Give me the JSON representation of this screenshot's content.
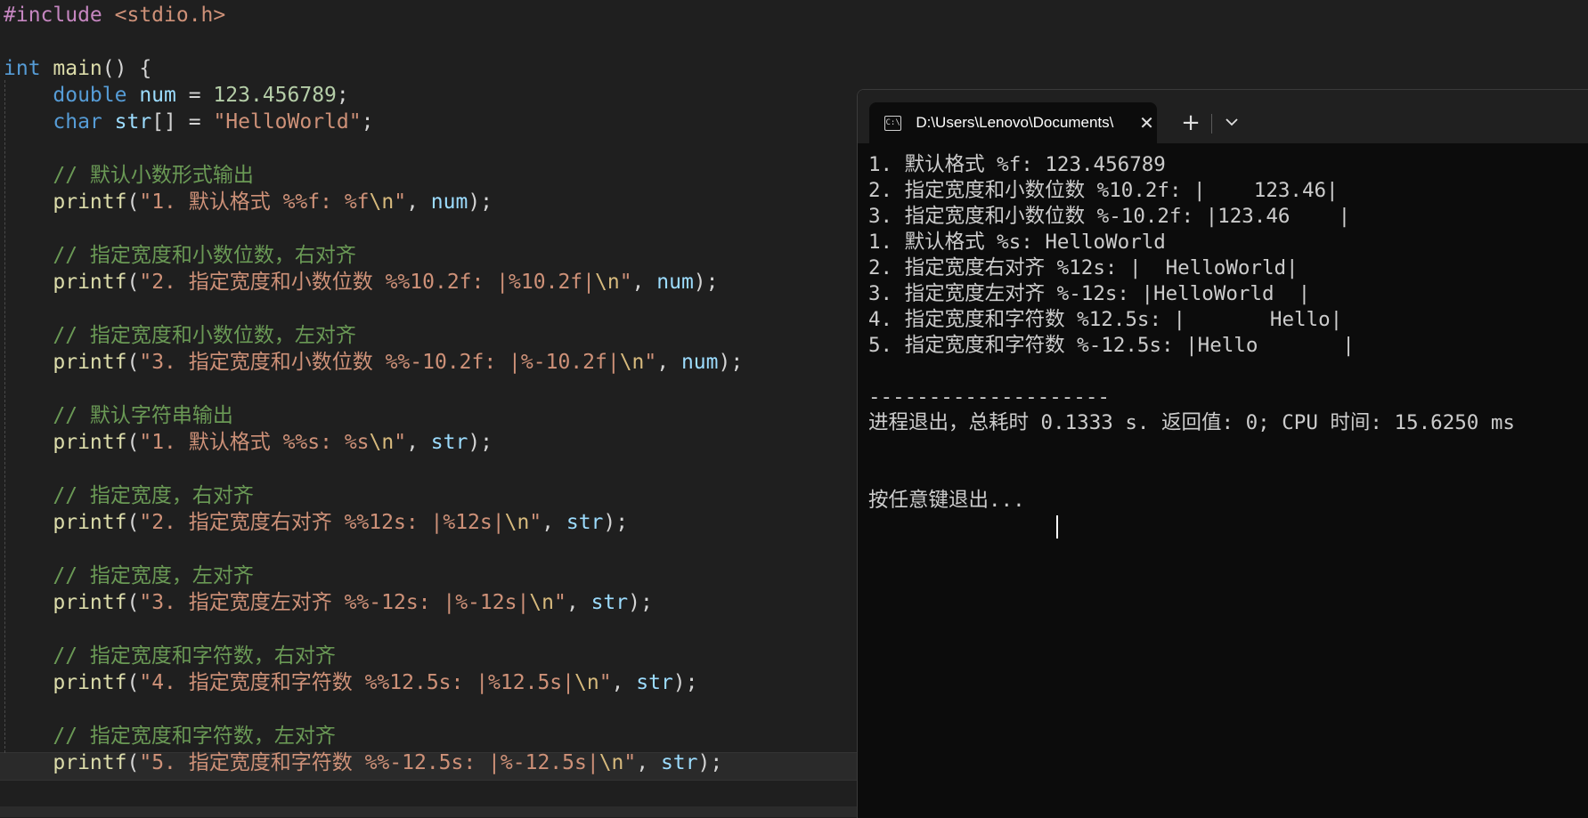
{
  "editor": {
    "lines": [
      [
        {
          "c": "t-dir",
          "t": "#include "
        },
        {
          "c": "t-inc",
          "t": "<stdio.h>"
        }
      ],
      [],
      [
        {
          "c": "t-kw",
          "t": "int "
        },
        {
          "c": "t-fn",
          "t": "main"
        },
        {
          "c": "t-pun",
          "t": "() {"
        }
      ],
      [
        {
          "c": "t-pun",
          "t": "    "
        },
        {
          "c": "t-kw",
          "t": "double "
        },
        {
          "c": "t-var",
          "t": "num"
        },
        {
          "c": "t-pun",
          "t": " = "
        },
        {
          "c": "t-num",
          "t": "123.456789"
        },
        {
          "c": "t-pun",
          "t": ";"
        }
      ],
      [
        {
          "c": "t-pun",
          "t": "    "
        },
        {
          "c": "t-kw",
          "t": "char "
        },
        {
          "c": "t-var",
          "t": "str"
        },
        {
          "c": "t-pun",
          "t": "[] = "
        },
        {
          "c": "t-str",
          "t": "\"HelloWorld\""
        },
        {
          "c": "t-pun",
          "t": ";"
        }
      ],
      [],
      [
        {
          "c": "t-pun",
          "t": "    "
        },
        {
          "c": "t-com",
          "t": "// 默认小数形式输出"
        }
      ],
      [
        {
          "c": "t-pun",
          "t": "    "
        },
        {
          "c": "t-fn",
          "t": "printf"
        },
        {
          "c": "t-pun",
          "t": "("
        },
        {
          "c": "t-str",
          "t": "\"1. 默认格式 %%f: %f"
        },
        {
          "c": "t-esc",
          "t": "\\n"
        },
        {
          "c": "t-str",
          "t": "\""
        },
        {
          "c": "t-pun",
          "t": ", "
        },
        {
          "c": "t-var",
          "t": "num"
        },
        {
          "c": "t-pun",
          "t": ");"
        }
      ],
      [],
      [
        {
          "c": "t-pun",
          "t": "    "
        },
        {
          "c": "t-com",
          "t": "// 指定宽度和小数位数，右对齐"
        }
      ],
      [
        {
          "c": "t-pun",
          "t": "    "
        },
        {
          "c": "t-fn",
          "t": "printf"
        },
        {
          "c": "t-pun",
          "t": "("
        },
        {
          "c": "t-str",
          "t": "\"2. 指定宽度和小数位数 %%10.2f: |%10.2f|"
        },
        {
          "c": "t-esc",
          "t": "\\n"
        },
        {
          "c": "t-str",
          "t": "\""
        },
        {
          "c": "t-pun",
          "t": ", "
        },
        {
          "c": "t-var",
          "t": "num"
        },
        {
          "c": "t-pun",
          "t": ");"
        }
      ],
      [],
      [
        {
          "c": "t-pun",
          "t": "    "
        },
        {
          "c": "t-com",
          "t": "// 指定宽度和小数位数，左对齐"
        }
      ],
      [
        {
          "c": "t-pun",
          "t": "    "
        },
        {
          "c": "t-fn",
          "t": "printf"
        },
        {
          "c": "t-pun",
          "t": "("
        },
        {
          "c": "t-str",
          "t": "\"3. 指定宽度和小数位数 %%-10.2f: |%-10.2f|"
        },
        {
          "c": "t-esc",
          "t": "\\n"
        },
        {
          "c": "t-str",
          "t": "\""
        },
        {
          "c": "t-pun",
          "t": ", "
        },
        {
          "c": "t-var",
          "t": "num"
        },
        {
          "c": "t-pun",
          "t": ");"
        }
      ],
      [],
      [
        {
          "c": "t-pun",
          "t": "    "
        },
        {
          "c": "t-com",
          "t": "// 默认字符串输出"
        }
      ],
      [
        {
          "c": "t-pun",
          "t": "    "
        },
        {
          "c": "t-fn",
          "t": "printf"
        },
        {
          "c": "t-pun",
          "t": "("
        },
        {
          "c": "t-str",
          "t": "\"1. 默认格式 %%s: %s"
        },
        {
          "c": "t-esc",
          "t": "\\n"
        },
        {
          "c": "t-str",
          "t": "\""
        },
        {
          "c": "t-pun",
          "t": ", "
        },
        {
          "c": "t-var",
          "t": "str"
        },
        {
          "c": "t-pun",
          "t": ");"
        }
      ],
      [],
      [
        {
          "c": "t-pun",
          "t": "    "
        },
        {
          "c": "t-com",
          "t": "// 指定宽度，右对齐"
        }
      ],
      [
        {
          "c": "t-pun",
          "t": "    "
        },
        {
          "c": "t-fn",
          "t": "printf"
        },
        {
          "c": "t-pun",
          "t": "("
        },
        {
          "c": "t-str",
          "t": "\"2. 指定宽度右对齐 %%12s: |%12s|"
        },
        {
          "c": "t-esc",
          "t": "\\n"
        },
        {
          "c": "t-str",
          "t": "\""
        },
        {
          "c": "t-pun",
          "t": ", "
        },
        {
          "c": "t-var",
          "t": "str"
        },
        {
          "c": "t-pun",
          "t": ");"
        }
      ],
      [],
      [
        {
          "c": "t-pun",
          "t": "    "
        },
        {
          "c": "t-com",
          "t": "// 指定宽度，左对齐"
        }
      ],
      [
        {
          "c": "t-pun",
          "t": "    "
        },
        {
          "c": "t-fn",
          "t": "printf"
        },
        {
          "c": "t-pun",
          "t": "("
        },
        {
          "c": "t-str",
          "t": "\"3. 指定宽度左对齐 %%-12s: |%-12s|"
        },
        {
          "c": "t-esc",
          "t": "\\n"
        },
        {
          "c": "t-str",
          "t": "\""
        },
        {
          "c": "t-pun",
          "t": ", "
        },
        {
          "c": "t-var",
          "t": "str"
        },
        {
          "c": "t-pun",
          "t": ");"
        }
      ],
      [],
      [
        {
          "c": "t-pun",
          "t": "    "
        },
        {
          "c": "t-com",
          "t": "// 指定宽度和字符数，右对齐"
        }
      ],
      [
        {
          "c": "t-pun",
          "t": "    "
        },
        {
          "c": "t-fn",
          "t": "printf"
        },
        {
          "c": "t-pun",
          "t": "("
        },
        {
          "c": "t-str",
          "t": "\"4. 指定宽度和字符数 %%12.5s: |%12.5s|"
        },
        {
          "c": "t-esc",
          "t": "\\n"
        },
        {
          "c": "t-str",
          "t": "\""
        },
        {
          "c": "t-pun",
          "t": ", "
        },
        {
          "c": "t-var",
          "t": "str"
        },
        {
          "c": "t-pun",
          "t": ");"
        }
      ],
      [],
      [
        {
          "c": "t-pun",
          "t": "    "
        },
        {
          "c": "t-com",
          "t": "// 指定宽度和字符数，左对齐"
        }
      ],
      [
        {
          "c": "t-pun",
          "t": "    "
        },
        {
          "c": "t-fn",
          "t": "printf"
        },
        {
          "c": "t-pun",
          "t": "("
        },
        {
          "c": "t-str",
          "t": "\"5. 指定宽度和字符数 %%-12.5s: |%-12.5s|"
        },
        {
          "c": "t-esc",
          "t": "\\n"
        },
        {
          "c": "t-str",
          "t": "\""
        },
        {
          "c": "t-pun",
          "t": ", "
        },
        {
          "c": "t-var",
          "t": "str"
        },
        {
          "c": "t-pun",
          "t": ");"
        }
      ]
    ]
  },
  "terminal": {
    "tab_title": "D:\\Users\\Lenovo\\Documents\\",
    "tab_icon": "C:\\",
    "close_glyph": "✕",
    "new_tab_glyph": "+",
    "output": [
      "1. 默认格式 %f: 123.456789",
      "2. 指定宽度和小数位数 %10.2f: |    123.46|",
      "3. 指定宽度和小数位数 %-10.2f: |123.46    |",
      "1. 默认格式 %s: HelloWorld",
      "2. 指定宽度右对齐 %12s: |  HelloWorld|",
      "3. 指定宽度左对齐 %-12s: |HelloWorld  |",
      "4. 指定宽度和字符数 %12.5s: |       Hello|",
      "5. 指定宽度和字符数 %-12.5s: |Hello       |",
      "",
      "--------------------",
      "进程退出，总耗时 0.1333 s. 返回值: 0; CPU 时间: 15.6250 ms",
      "",
      "",
      "按任意键退出..."
    ]
  },
  "colors": {
    "editor_bg": "#1f1f1f",
    "terminal_bg": "#0c0c0c",
    "keyword": "#569cd6",
    "function": "#dcdcaa",
    "string": "#ce9178",
    "comment": "#6a9955",
    "number": "#b5cea8",
    "variable": "#9cdcfe",
    "directive": "#c586c0"
  }
}
